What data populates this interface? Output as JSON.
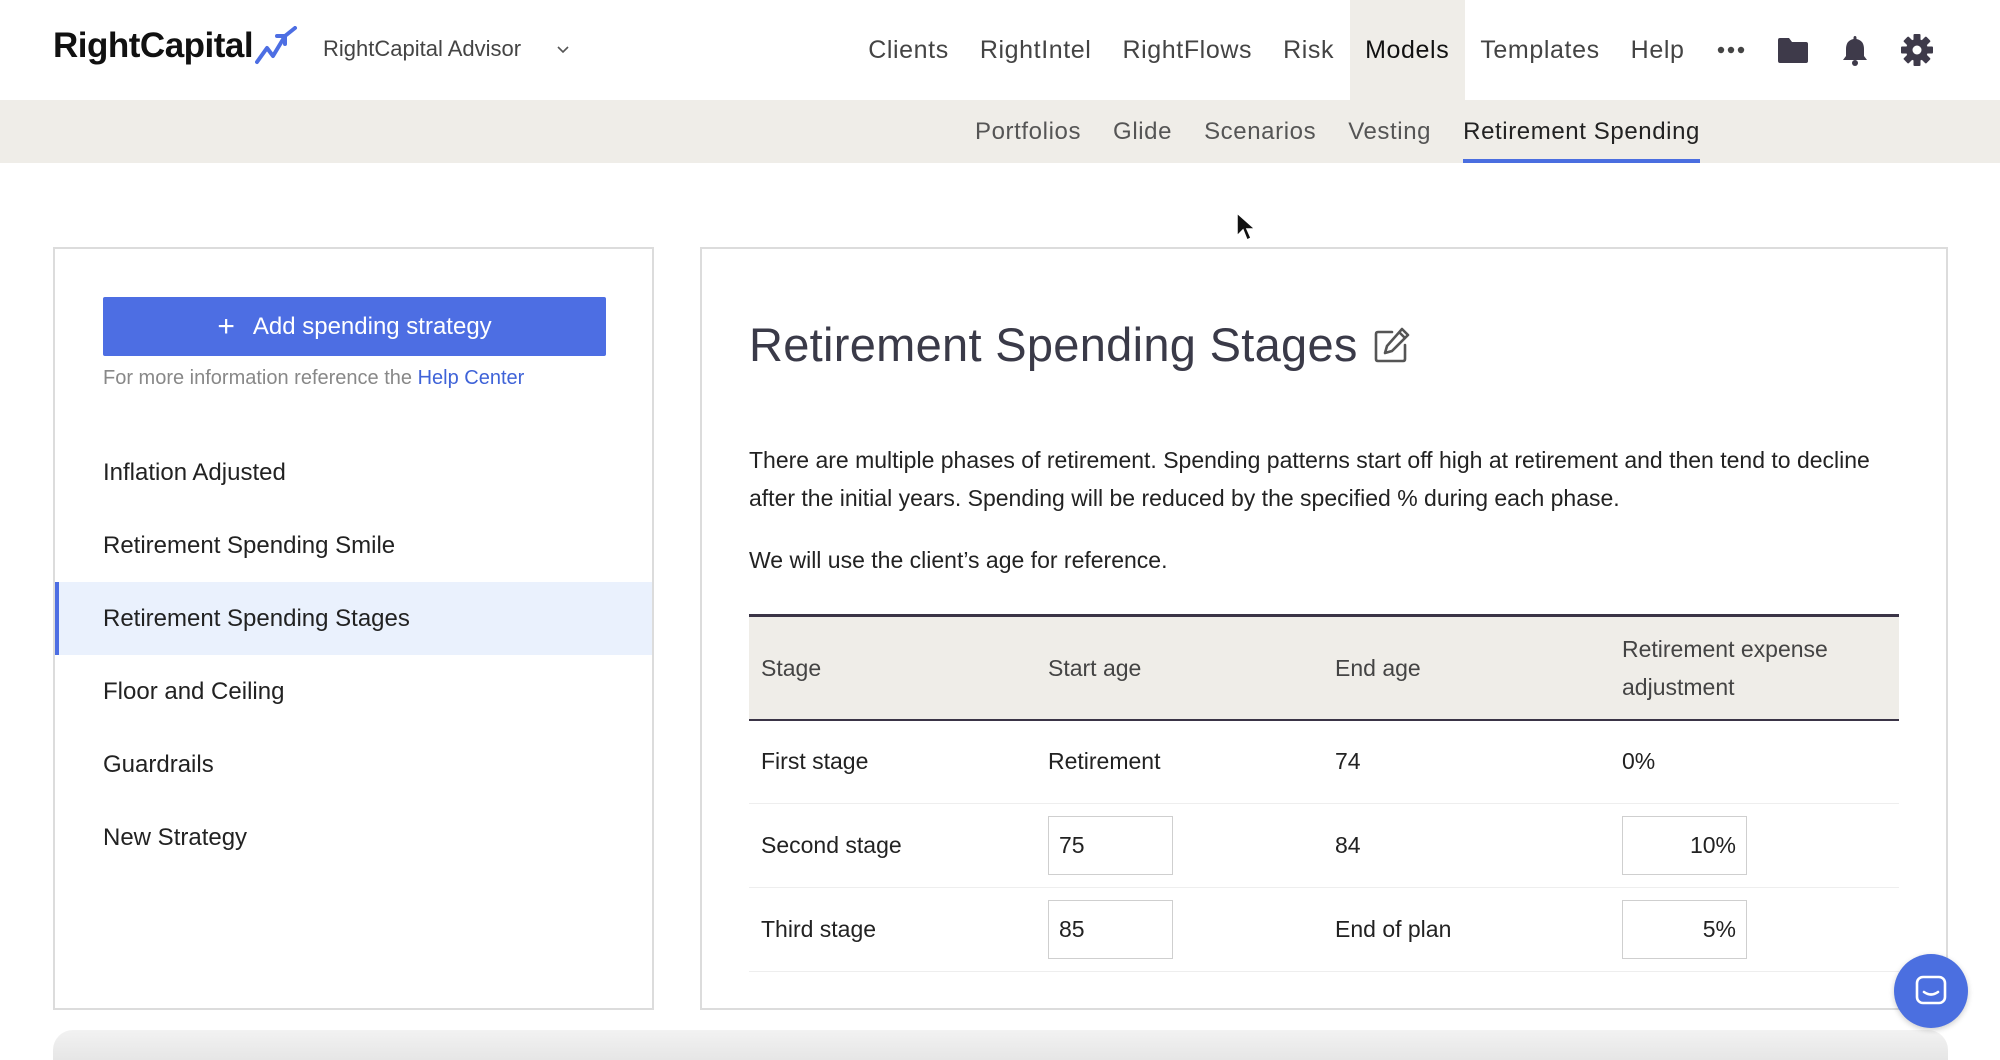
{
  "header": {
    "logo_text": "RightCapital",
    "advisor_label": "RightCapital Advisor",
    "nav": [
      {
        "label": "Clients",
        "active": false
      },
      {
        "label": "RightIntel",
        "active": false
      },
      {
        "label": "RightFlows",
        "active": false
      },
      {
        "label": "Risk",
        "active": false
      },
      {
        "label": "Models",
        "active": true
      },
      {
        "label": "Templates",
        "active": false
      },
      {
        "label": "Help",
        "active": false
      }
    ],
    "icons": [
      "more-icon",
      "folder-icon",
      "bell-icon",
      "gear-icon"
    ]
  },
  "subnav": {
    "items": [
      {
        "label": "Portfolios",
        "active": false
      },
      {
        "label": "Glide",
        "active": false
      },
      {
        "label": "Scenarios",
        "active": false
      },
      {
        "label": "Vesting",
        "active": false
      },
      {
        "label": "Retirement Spending",
        "active": true
      }
    ]
  },
  "sidebar": {
    "add_button_label": "Add spending strategy",
    "help_text": "For more information reference the ",
    "help_link": "Help Center",
    "strategies": [
      {
        "label": "Inflation Adjusted",
        "selected": false
      },
      {
        "label": "Retirement Spending Smile",
        "selected": false
      },
      {
        "label": "Retirement Spending Stages",
        "selected": true
      },
      {
        "label": "Floor and Ceiling",
        "selected": false
      },
      {
        "label": "Guardrails",
        "selected": false
      },
      {
        "label": "New Strategy",
        "selected": false
      }
    ]
  },
  "main": {
    "title": "Retirement Spending Stages",
    "description": "There are multiple phases of retirement. Spending patterns start off high at retirement and then tend to decline after the initial years. Spending will be reduced by the specified % during each phase.",
    "reference_note": "We will use the client’s age for reference.",
    "table": {
      "headers": [
        "Stage",
        "Start age",
        "End age",
        "Retirement expense adjustment"
      ],
      "rows": [
        {
          "stage": "First stage",
          "start_age": "Retirement",
          "end_age": "74",
          "adjustment": "0%"
        },
        {
          "stage": "Second stage",
          "start_age": "75",
          "end_age": "84",
          "adjustment": "10%"
        },
        {
          "stage": "Third stage",
          "start_age": "85",
          "end_age": "End of plan",
          "adjustment": "5%"
        }
      ]
    }
  },
  "colors": {
    "accent": "#4d6ee3",
    "nav_active_bg": "#efede8",
    "selected_bg": "#eaf1fd"
  }
}
